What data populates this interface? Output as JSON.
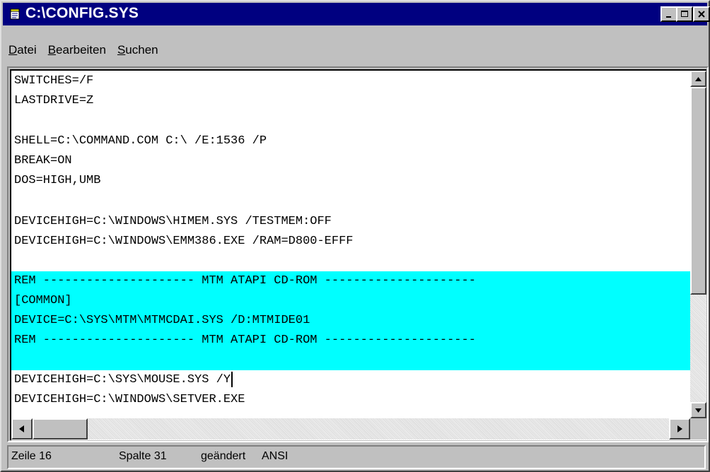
{
  "window": {
    "title": "C:\\CONFIG.SYS",
    "icon": "notepad-icon",
    "controls": {
      "minimize": "minimize-icon",
      "maximize": "maximize-icon",
      "close": "close-icon"
    }
  },
  "menu": {
    "items": [
      {
        "accel": "D",
        "rest": "atei"
      },
      {
        "accel": "B",
        "rest": "earbeiten"
      },
      {
        "accel": "S",
        "rest": "uchen"
      }
    ]
  },
  "editor": {
    "lines": [
      "SWITCHES=/F",
      "LASTDRIVE=Z",
      "",
      "SHELL=C:\\COMMAND.COM C:\\ /E:1536 /P",
      "BREAK=ON",
      "DOS=HIGH,UMB",
      "",
      "DEVICEHIGH=C:\\WINDOWS\\HIMEM.SYS /TESTMEM:OFF",
      "DEVICEHIGH=C:\\WINDOWS\\EMM386.EXE /RAM=D800-EFFF",
      "",
      "REM --------------------- MTM ATAPI CD-ROM ---------------------",
      "[COMMON]",
      "DEVICE=C:\\SYS\\MTM\\MTMCDAI.SYS /D:MTMIDE01",
      "REM --------------------- MTM ATAPI CD-ROM ---------------------",
      "",
      "DEVICEHIGH=C:\\SYS\\MOUSE.SYS /Y",
      "DEVICEHIGH=C:\\WINDOWS\\SETVER.EXE"
    ],
    "selection_color": "#00ffff"
  },
  "status": {
    "line": "Zeile 16",
    "column": "Spalte 31",
    "modified": "geändert",
    "encoding": "ANSI"
  }
}
